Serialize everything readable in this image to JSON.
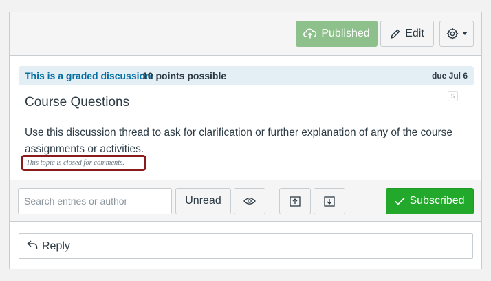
{
  "header": {
    "published_label": "Published",
    "edit_label": "Edit"
  },
  "graded": {
    "prefix": "This is a graded discussion:",
    "points": "10 points possible",
    "due": "due Jul 6"
  },
  "topic": {
    "title": "Course Questions",
    "reply_count": "5",
    "body": "Use this discussion thread to ask for clarification or further explanation of any of the course assignments or activities.",
    "closed_notice": "This topic is closed for comments."
  },
  "toolbar": {
    "search_placeholder": "Search entries or author",
    "unread_label": "Unread",
    "subscribed_label": "Subscribed"
  },
  "reply": {
    "label": "Reply"
  },
  "colors": {
    "published_bg": "#8ec08c",
    "subscribed_bg": "#22a82a",
    "graded_bg": "#e4eef5",
    "link_blue": "#0770a3",
    "highlight_border": "#8b1b1b"
  },
  "icons": {
    "published": "cloud-upload-icon",
    "edit": "pencil-icon",
    "settings": "gear-icon",
    "dropdown": "caret-down-icon",
    "eye": "eye-icon",
    "collapse": "collapse-up-icon",
    "expand": "expand-down-icon",
    "check": "checkmark-icon",
    "reply": "reply-arrow-icon"
  }
}
